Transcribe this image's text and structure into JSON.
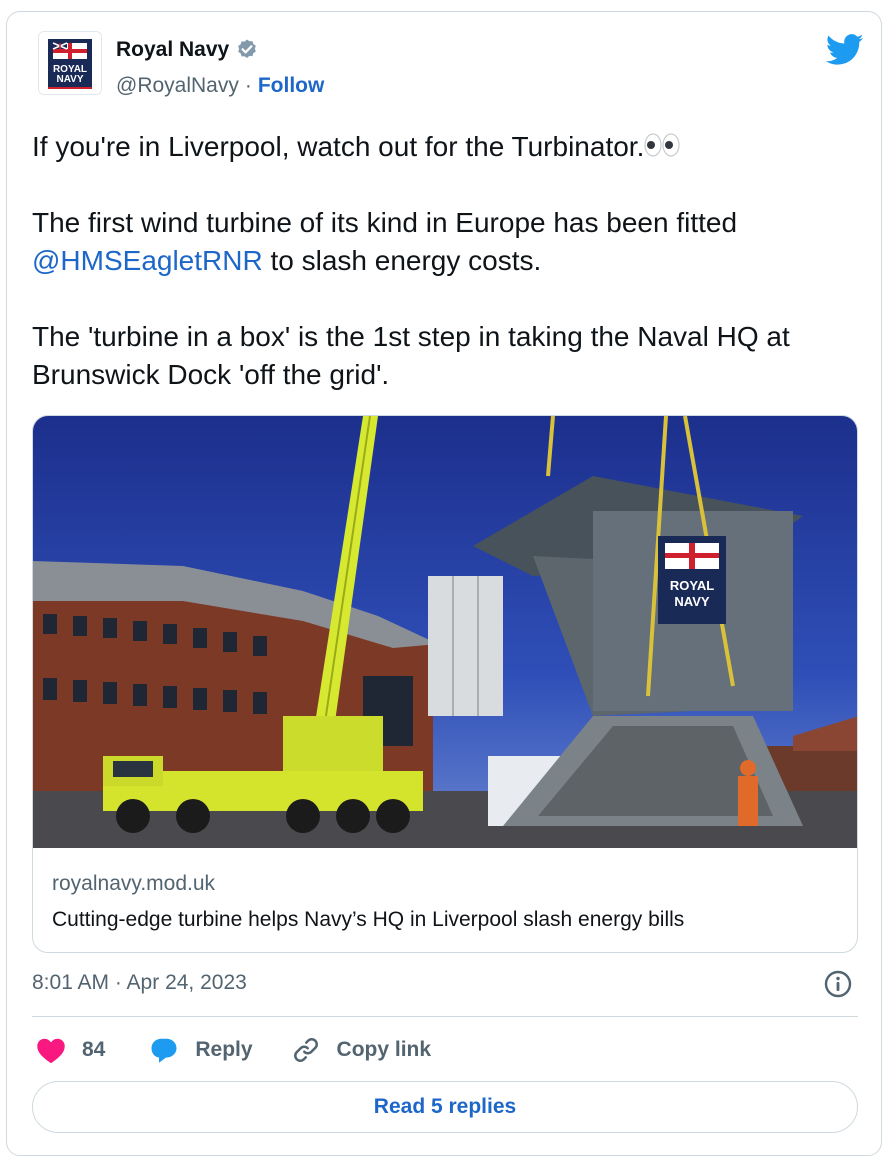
{
  "author": {
    "name": "Royal Navy",
    "handle": "@RoyalNavy",
    "separator": "·",
    "follow_label": "Follow",
    "avatar_text_line1": "ROYAL",
    "avatar_text_line2": "NAVY"
  },
  "tweet": {
    "line1": "If you're in Liverpool, watch out for the Turbinator.",
    "line2_before": "The first wind turbine of its kind in Europe has been fitted ",
    "mention": "@HMSEagletRNR",
    "line2_after": " to slash energy costs.",
    "line3": "The 'turbine in a box' is the 1st step in taking the Naval HQ at Brunswick Dock 'off the grid'."
  },
  "link_card": {
    "domain": "royalnavy.mod.uk",
    "title": "Cutting-edge turbine helps Navy’s HQ in Liverpool slash energy bills",
    "image_box_text1": "ROYAL",
    "image_box_text2": "NAVY"
  },
  "timestamp": "8:01 AM · Apr 24, 2023",
  "actions": {
    "like_count": "84",
    "reply_label": "Reply",
    "copy_link_label": "Copy link"
  },
  "read_replies_label": "Read 5 replies",
  "colors": {
    "link": "#1d67c9",
    "like": "#f91880",
    "reply_icon": "#1d9bf0",
    "twitter": "#1d9bf0",
    "secondary_text": "#536471"
  },
  "icons": [
    "verified-badge-icon",
    "twitter-bird-icon",
    "eyes-emoji-icon",
    "info-icon",
    "heart-icon",
    "speech-bubble-icon",
    "link-chain-icon"
  ]
}
